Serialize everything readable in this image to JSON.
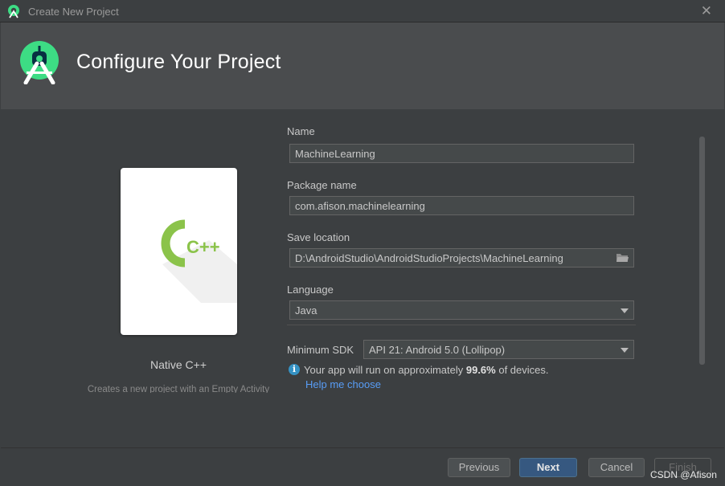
{
  "window": {
    "title": "Create New Project",
    "close_glyph": "✕"
  },
  "header": {
    "title": "Configure Your Project"
  },
  "template": {
    "name": "Native C++",
    "description": "Creates a new project with an Empty Activity",
    "icon_text": "C++"
  },
  "form": {
    "name": {
      "label": "Name",
      "value": "MachineLearning"
    },
    "package": {
      "label": "Package name",
      "value": "com.afison.machinelearning"
    },
    "save_location": {
      "label": "Save location",
      "value": "D:\\AndroidStudio\\AndroidStudioProjects\\MachineLearning"
    },
    "language": {
      "label": "Language",
      "value": "Java"
    },
    "min_sdk": {
      "label": "Minimum SDK",
      "value": "API 21: Android 5.0 (Lollipop)"
    }
  },
  "info": {
    "prefix": "Your app will run on approximately ",
    "percent": "99.6%",
    "suffix": " of devices.",
    "help_link": "Help me choose"
  },
  "buttons": {
    "previous": "Previous",
    "next": "Next",
    "cancel": "Cancel",
    "finish": "Finish"
  },
  "watermark": "CSDN @Afison",
  "colors": {
    "accent": "#365880",
    "link": "#589df6",
    "android_green": "#3ddc84",
    "cpp_green": "#8bc34a"
  }
}
